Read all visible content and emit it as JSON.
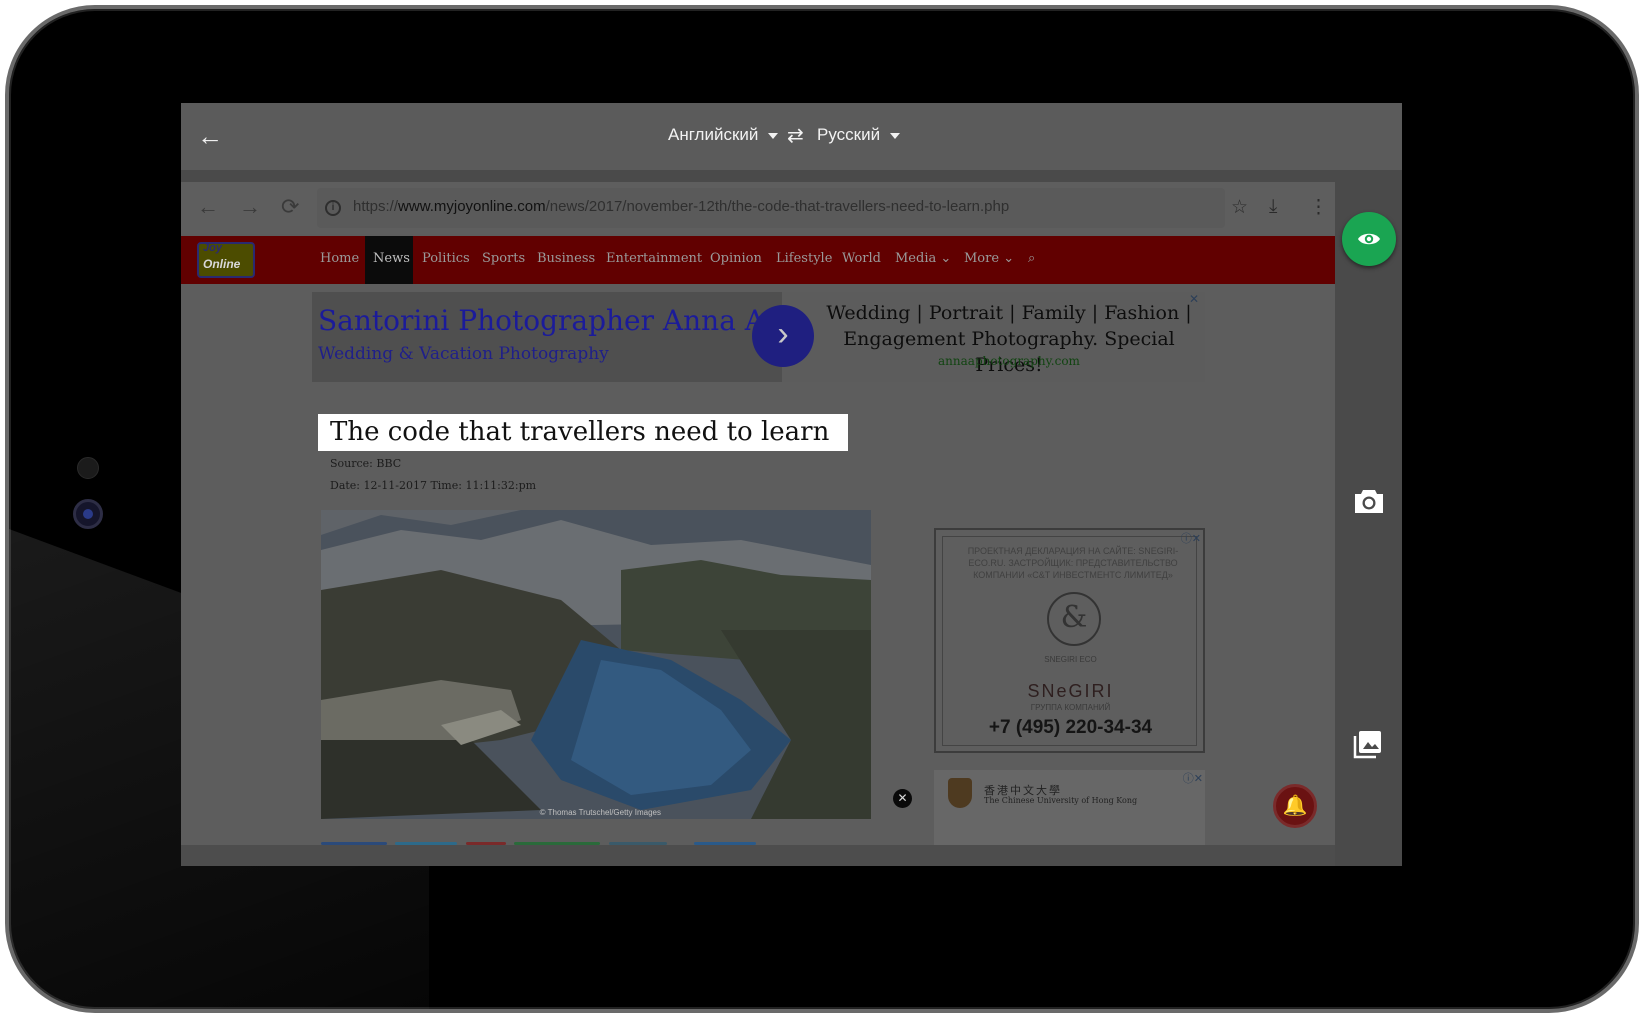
{
  "topbar": {
    "back_icon": "arrow-left-icon",
    "source_language": "Английский",
    "target_language": "Русский",
    "swap_icon": "swap-arrows-icon"
  },
  "browser": {
    "url_prefix": "https://",
    "url_host": "www.myjoyonline.com",
    "url_path": "/news/2017/november-12th/the-code-that-travellers-need-to-learn.php",
    "icons": [
      "back-arrow-icon",
      "forward-arrow-icon",
      "reload-icon",
      "info-icon",
      "star-icon",
      "download-icon",
      "more-vert-icon"
    ]
  },
  "site": {
    "logo_text": "Online",
    "logo_top_text": "Joy",
    "nav": [
      "Home",
      "News",
      "Politics",
      "Sports",
      "Business",
      "Entertainment",
      "Opinion",
      "Lifestyle",
      "World",
      "Media",
      "More"
    ],
    "active_nav": "News"
  },
  "ad_banner": {
    "title": "Santorini Photographer Anna A.",
    "subtitle": "Wedding & Vacation Photography",
    "copy_line1": "Wedding | Portrait | Family | Fashion |",
    "copy_line2": "Engagement Photography. Special Prices!",
    "domain": "annaaphotography.com"
  },
  "article": {
    "headline": "The code that travellers need to learn",
    "source_label": "Source:",
    "source_value": "BBC",
    "date_label": "Date:",
    "date_value": "12-11-2017",
    "time_label": "Time:",
    "time_value": "11:11:32:pm",
    "photo_credit": "© Thomas Trutschel/Getty Images"
  },
  "ad_side": {
    "header": "ПРОЕКТНАЯ ДЕКЛАРАЦИЯ НА САЙТЕ: SNEGIRI-ECO.RU. ЗАСТРОЙЩИК: ПРЕДСТАВИТЕЛЬСТВО КОМПАНИИ «С&Т ИНВЕСТМЕНТС ЛИМИТЕД»",
    "logo_brand": "SNEGIRI ECO",
    "brand": "SNeGIRI",
    "brand_sub": "ГРУППА КОМПАНИЙ",
    "phone": "+7 (495) 220-34-34"
  },
  "ad_univ": {
    "name_cn": "香港中文大學",
    "name_en": "The Chinese University of Hong Kong"
  },
  "side_actions": [
    "eye-icon",
    "camera-icon",
    "gallery-icon"
  ],
  "colors": {
    "accent_green": "#1aa552",
    "nav_red": "#610000",
    "topbar": "#5b5b5b"
  }
}
